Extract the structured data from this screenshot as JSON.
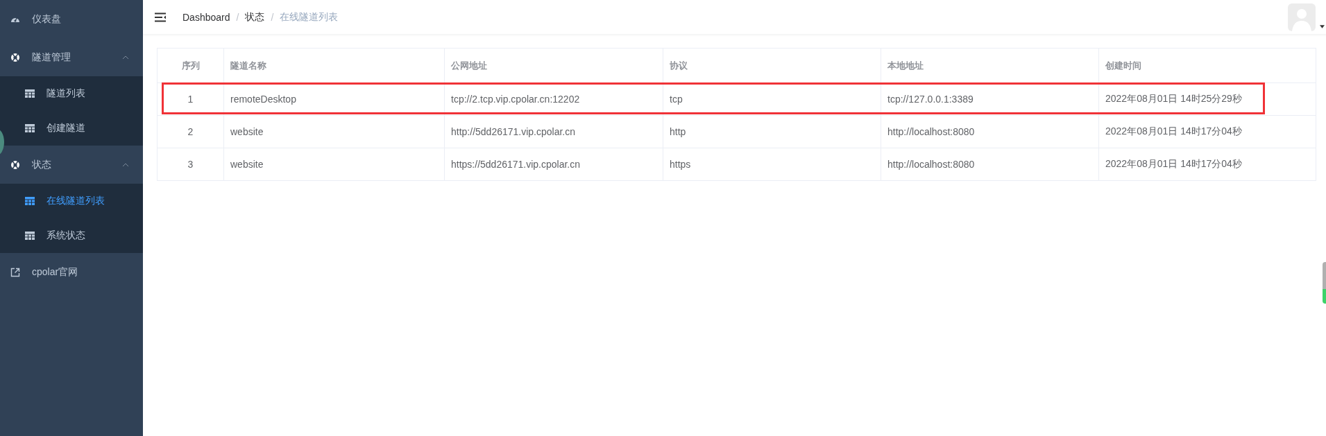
{
  "sidebar": {
    "items": [
      {
        "label": "仪表盘",
        "kind": "dashboard",
        "selected": false
      },
      {
        "label": "隧道管理",
        "kind": "group",
        "expanded": true,
        "children": [
          {
            "label": "隧道列表",
            "selected": false
          },
          {
            "label": "创建隧道",
            "selected": false
          }
        ]
      },
      {
        "label": "状态",
        "kind": "group",
        "expanded": true,
        "children": [
          {
            "label": "在线隧道列表",
            "selected": true
          },
          {
            "label": "系统状态",
            "selected": false
          }
        ]
      },
      {
        "label": "cpolar官网",
        "kind": "link",
        "selected": false
      }
    ]
  },
  "breadcrumb": [
    {
      "label": "Dashboard"
    },
    {
      "separator": "/",
      "label": "状态"
    },
    {
      "separator": "/",
      "label": "在线隧道列表"
    }
  ],
  "table": {
    "columns": [
      "序列",
      "隧道名称",
      "公网地址",
      "协议",
      "本地地址",
      "创建时间"
    ],
    "rows": [
      {
        "cells": [
          "1",
          "remoteDesktop",
          "tcp://2.tcp.vip.cpolar.cn:12202",
          "tcp",
          "tcp://127.0.0.1:3389",
          "2022年08月01日 14时25分29秒"
        ],
        "highlighted": true
      },
      {
        "cells": [
          "2",
          "website",
          "http://5dd26171.vip.cpolar.cn",
          "http",
          "http://localhost:8080",
          "2022年08月01日 14时17分04秒"
        ],
        "highlighted": false
      },
      {
        "cells": [
          "3",
          "website",
          "https://5dd26171.vip.cpolar.cn",
          "https",
          "http://localhost:8080",
          "2022年08月01日 14时17分04秒"
        ],
        "highlighted": false
      }
    ]
  }
}
